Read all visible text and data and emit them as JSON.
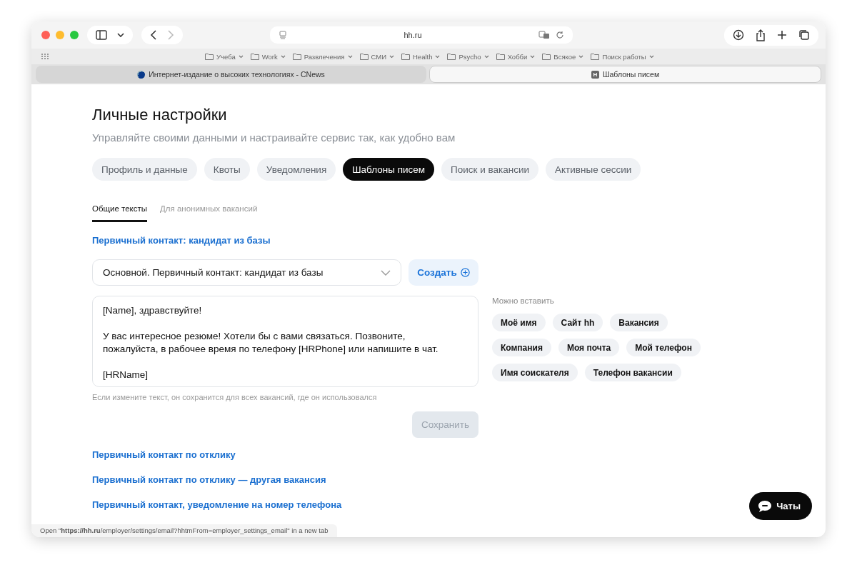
{
  "browser": {
    "address": "hh.ru",
    "bookmarks": [
      "Учеба",
      "Work",
      "Развлечения",
      "СМИ",
      "Health",
      "Psycho",
      "Хобби",
      "Всякое",
      "Поиск работы"
    ],
    "tabs": [
      {
        "title": "Интернет-издание о высоких технологиях - CNews",
        "selected": false,
        "kind": "globe"
      },
      {
        "title": "Шаблоны писем",
        "selected": true,
        "kind": "letter",
        "icon_text": "H"
      }
    ]
  },
  "page": {
    "title": "Личные настройки",
    "subtitle": "Управляйте своими данными и настраивайте сервис так, как удобно вам",
    "tabs": [
      {
        "label": "Профиль и данные",
        "selected": false
      },
      {
        "label": "Квоты",
        "selected": false
      },
      {
        "label": "Уведомления",
        "selected": false
      },
      {
        "label": "Шаблоны писем",
        "selected": true
      },
      {
        "label": "Поиск и вакансии",
        "selected": false
      },
      {
        "label": "Активные сессии",
        "selected": false
      }
    ],
    "subtabs": [
      {
        "label": "Общие тексты",
        "selected": true
      },
      {
        "label": "Для анонимных вакансий",
        "selected": false
      }
    ],
    "section_link": "Первичный контакт: кандидат из базы",
    "template_select": {
      "value": "Основной. Первичный контакт: кандидат из базы"
    },
    "create_button": "Создать",
    "message": {
      "value": "[Name], здравствуйте!\n\nУ вас интересное резюме! Хотели бы с вами связаться. Позвоните, пожалуйста, в рабочее время по телефону [HRPhone] или напишите в чат.\n\n[HRName]"
    },
    "hint": "Если измените текст, он сохранится для всех вакансий, где он использовался",
    "save_button": {
      "label": "Сохранить",
      "disabled": true
    },
    "insert": {
      "label": "Можно вставить",
      "chips": [
        [
          "Моё имя",
          "Сайт hh",
          "Вакансия"
        ],
        [
          "Компания",
          "Моя почта",
          "Мой телефон"
        ],
        [
          "Имя соискателя",
          "Телефон вакансии"
        ]
      ]
    },
    "links": [
      "Первичный контакт по отклику",
      "Первичный контакт по отклику — другая вакансия",
      "Первичный контакт, уведомление на номер телефона"
    ],
    "chat_button": "Чаты"
  },
  "status_bar": "Open \"**https://hh.ru**/employer/settings/email?hhtmFrom=employer_settings_email\" in a new tab"
}
